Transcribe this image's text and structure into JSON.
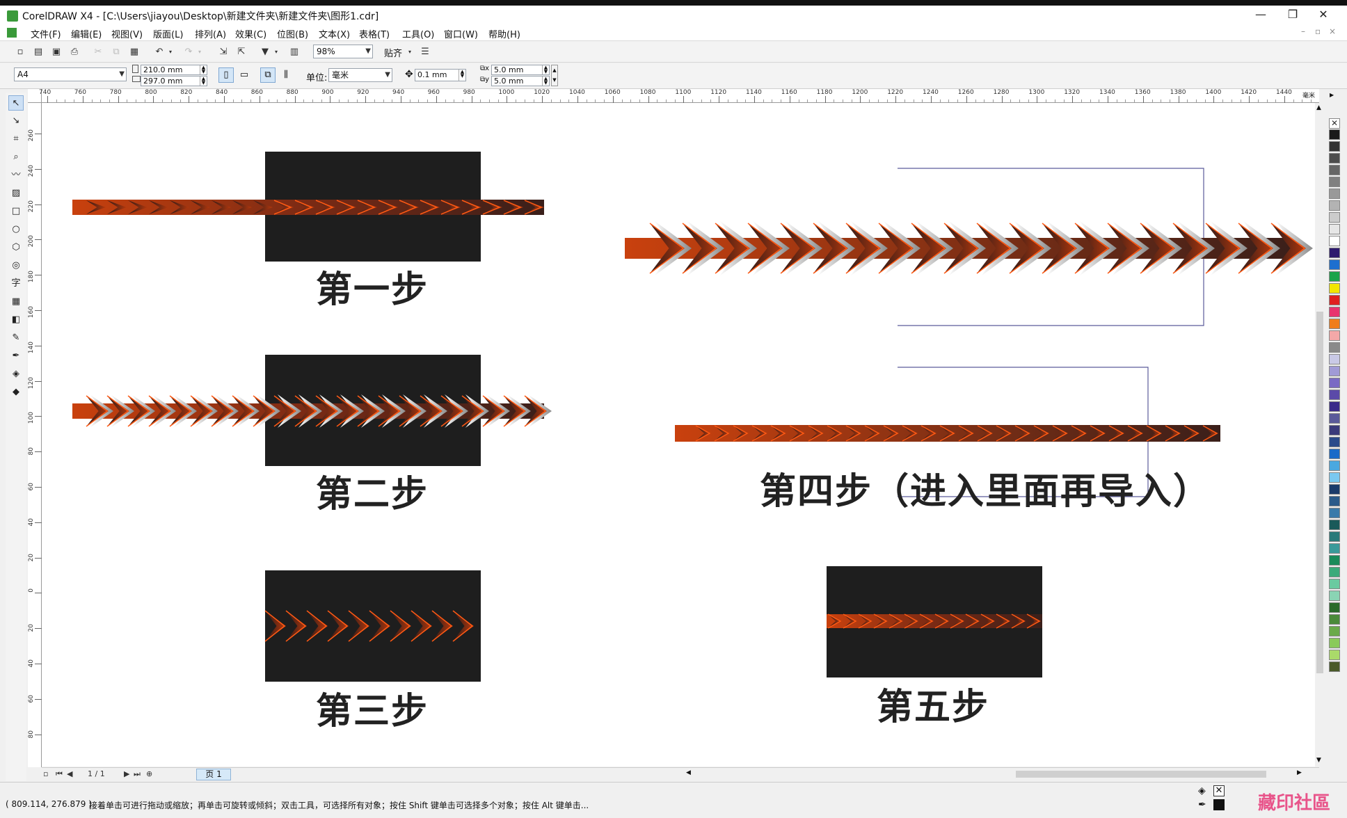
{
  "window": {
    "title": "CorelDRAW X4 - [C:\\Users\\jiayou\\Desktop\\新建文件夹\\新建文件夹\\图形1.cdr]",
    "minimize": "—",
    "restore": "❐",
    "close": "✕"
  },
  "menu": {
    "items": [
      "文件(F)",
      "编辑(E)",
      "视图(V)",
      "版面(L)",
      "排列(A)",
      "效果(C)",
      "位图(B)",
      "文本(X)",
      "表格(T)",
      "工具(O)",
      "窗口(W)",
      "帮助(H)"
    ],
    "doc_controls": [
      "–",
      "▫",
      "×"
    ]
  },
  "toolbar": {
    "zoom": "98%",
    "snap": "贴齐"
  },
  "property_bar": {
    "page_size": "A4",
    "width": "210.0 mm",
    "height": "297.0 mm",
    "unit_label": "单位:",
    "unit": "毫米",
    "nudge": "0.1 mm",
    "dup_x": "5.0 mm",
    "dup_y": "5.0 mm"
  },
  "ruler": {
    "h_ticks": [
      "740",
      "760",
      "780",
      "800",
      "820",
      "840",
      "860",
      "880",
      "900",
      "920",
      "940",
      "960",
      "980",
      "1000",
      "1020",
      "1040",
      "1060",
      "1080",
      "1100",
      "1120",
      "1140",
      "1160",
      "1180",
      "1200",
      "1220",
      "1240",
      "1260",
      "1280",
      "1300",
      "1320",
      "1340",
      "1360",
      "1380",
      "1400",
      "1420",
      "1440"
    ],
    "h_unit": "毫米",
    "v_ticks": [
      "260",
      "240",
      "220",
      "200",
      "180",
      "160",
      "140",
      "120",
      "100",
      "80",
      "60",
      "40",
      "20",
      "0",
      "20",
      "40",
      "60",
      "80"
    ]
  },
  "canvas": {
    "step1": "第一步",
    "step2": "第二步",
    "step3": "第三步",
    "step4": "第四步（进入里面再导入）",
    "step5": "第五步"
  },
  "pagebar": {
    "page_count": "1 / 1",
    "page_tab": "页 1"
  },
  "status": {
    "coords": "( 809.114, 276.879 )",
    "hint": "接着单击可进行拖动或缩放；再单击可旋转或倾斜；双击工具，可选择所有对象；按住 Shift 键单击可选择多个对象；按住 Alt 键单击..."
  },
  "watermark": "藏印社區",
  "colors": {
    "palette": [
      "#1a1a1a",
      "#333333",
      "#4d4d4d",
      "#666666",
      "#808080",
      "#999999",
      "#b3b3b3",
      "#cccccc",
      "#e6e6e6",
      "#ffffff",
      "#2e1a6e",
      "#1e6fcf",
      "#1aa34a",
      "#f2e600",
      "#e02020",
      "#e8336e",
      "#f07d1a",
      "#f4a8a8",
      "#8a8a8a",
      "#c9c9e6",
      "#a09ad6",
      "#7a6ac4",
      "#5b4aa8",
      "#3a2a8a",
      "#5a5a9a",
      "#3a3a7a",
      "#2a4a8a",
      "#1a6ac8",
      "#4aa8e0",
      "#7ac8f0",
      "#1a3a6a",
      "#2a5a8a",
      "#3a7aaa",
      "#1a5a5a",
      "#2a7a7a",
      "#3a9a9a",
      "#1a8a5a",
      "#3aaa7a",
      "#6acaa0",
      "#8ad4b4",
      "#2a6a2a",
      "#4a8a3a",
      "#6aaa4a",
      "#8aca5a",
      "#aada6a",
      "#4a5a2a"
    ],
    "bar_orange": "#c9410e",
    "bar_dark": "#3a1f1a",
    "chevron_orange": "#ff5a14"
  }
}
